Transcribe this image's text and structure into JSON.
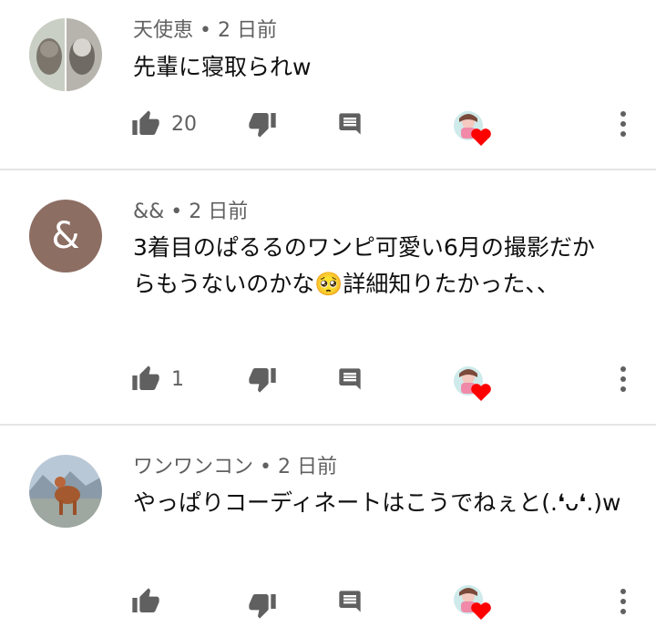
{
  "comments": [
    {
      "author": "天使恵",
      "time": "2 日前",
      "text": "先輩に寝取られw",
      "likes": "20",
      "avatar_type": "photo-cats"
    },
    {
      "author": "&&",
      "time": "2 日前",
      "text": "3着目のぱるるのワンピ可愛い6月の撮影だからもうないのかな🥺詳細知りたかった、、",
      "likes": "1",
      "avatar_initial": "&",
      "avatar_color": "#8d6e63"
    },
    {
      "author": "ワンワンコン",
      "time": "2 日前",
      "text": "やっぱりコーディネートはこうでねぇと(.❛ᴗ❛.)w",
      "likes": "",
      "avatar_type": "photo-dog"
    }
  ],
  "separator": " • ",
  "icons": {
    "like": "thumb-up-icon",
    "dislike": "thumb-down-icon",
    "reply": "reply-comment-icon",
    "creator_heart": "creator-heart-icon",
    "more": "more-vert-icon"
  },
  "colors": {
    "icon_gray": "#606060",
    "heart_red": "#ff0000",
    "divider": "#e5e5e5"
  }
}
